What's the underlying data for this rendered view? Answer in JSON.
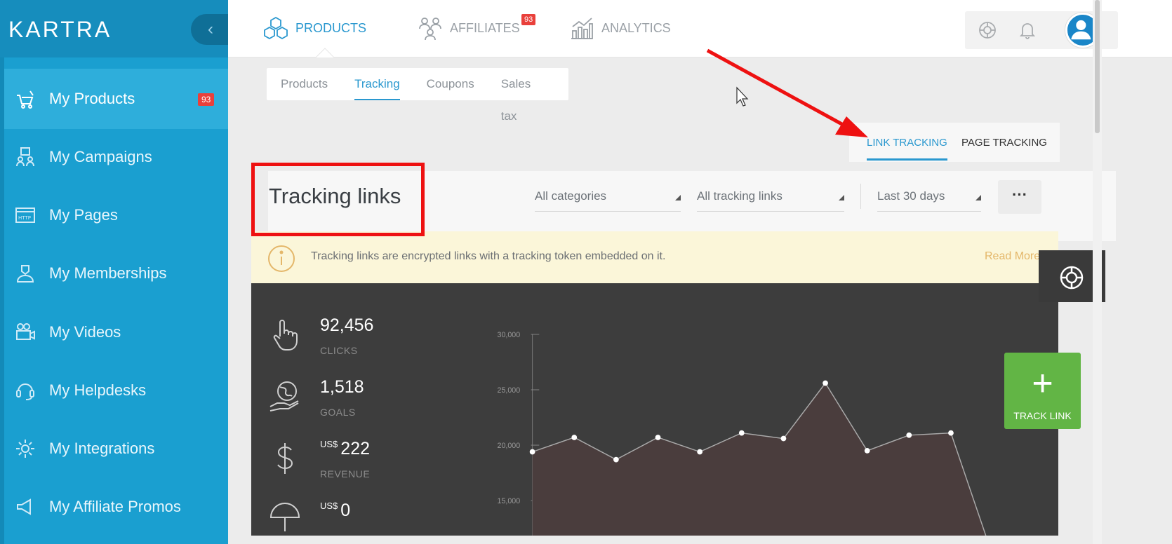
{
  "brand": {
    "name": "KARTRA"
  },
  "sidebar": {
    "collapse_glyph": "‹",
    "items": [
      {
        "label": "My Products",
        "icon": "cart-icon",
        "badge": "93",
        "active": true
      },
      {
        "label": "My Campaigns",
        "icon": "campaigns-icon"
      },
      {
        "label": "My Pages",
        "icon": "http-page-icon"
      },
      {
        "label": "My Memberships",
        "icon": "memberships-icon"
      },
      {
        "label": "My Videos",
        "icon": "video-icon"
      },
      {
        "label": "My Helpdesks",
        "icon": "headset-icon"
      },
      {
        "label": "My Integrations",
        "icon": "gear-icon"
      },
      {
        "label": "My Affiliate Promos",
        "icon": "megaphone-icon"
      }
    ]
  },
  "topnav": {
    "items": [
      {
        "label": "PRODUCTS",
        "icon": "boxes-icon",
        "active": true
      },
      {
        "label": "AFFILIATES",
        "icon": "affiliates-icon",
        "badge": "93"
      },
      {
        "label": "ANALYTICS",
        "icon": "analytics-icon"
      }
    ],
    "tools": [
      "lifebuoy-icon",
      "bell-icon",
      "user-avatar-icon"
    ]
  },
  "subtabs": [
    {
      "label": "Products"
    },
    {
      "label": "Tracking",
      "active": true
    },
    {
      "label": "Coupons"
    },
    {
      "label": "Sales tax"
    }
  ],
  "tracking_tabs": [
    {
      "label": "LINK TRACKING",
      "active": true
    },
    {
      "label": "PAGE TRACKING"
    }
  ],
  "page": {
    "title": "Tracking links",
    "filters": {
      "category": "All categories",
      "links": "All tracking links",
      "range": "Last 30 days",
      "more": "···"
    },
    "info": {
      "text": "Tracking links are encrypted links with a tracking token embedded on it.",
      "read_more": "Read More"
    }
  },
  "stats": [
    {
      "value": "92,456",
      "label": "CLICKS",
      "icon": "pointer-hand-icon"
    },
    {
      "value": "1,518",
      "label": "GOALS",
      "icon": "globe-hand-icon"
    },
    {
      "value": "222",
      "currency": "US$",
      "label": "REVENUE",
      "icon": "dollar-icon"
    },
    {
      "value": "0",
      "currency": "US$",
      "label": "",
      "icon": "umbrella-icon"
    }
  ],
  "chart_data": {
    "type": "area",
    "y_ticks": [
      "30,000",
      "25,000",
      "20,000",
      "15,000"
    ],
    "ylim": [
      10000,
      30000
    ],
    "values": [
      19400,
      20700,
      18700,
      20700,
      19400,
      21100,
      20600,
      25600,
      19500,
      20900,
      21100,
      10000
    ],
    "colors": {
      "fill": "#4a3d3d",
      "line": "#aaaaaa",
      "point": "#ffffff"
    }
  },
  "floating": {
    "track_link_label": "TRACK LINK",
    "track_link_plus": "+"
  },
  "colors": {
    "sidebar": "#1a9fd0",
    "accent": "#2a98cf",
    "badge": "#e9403b",
    "track_link": "#62b545",
    "annotation": "#ee1111"
  }
}
